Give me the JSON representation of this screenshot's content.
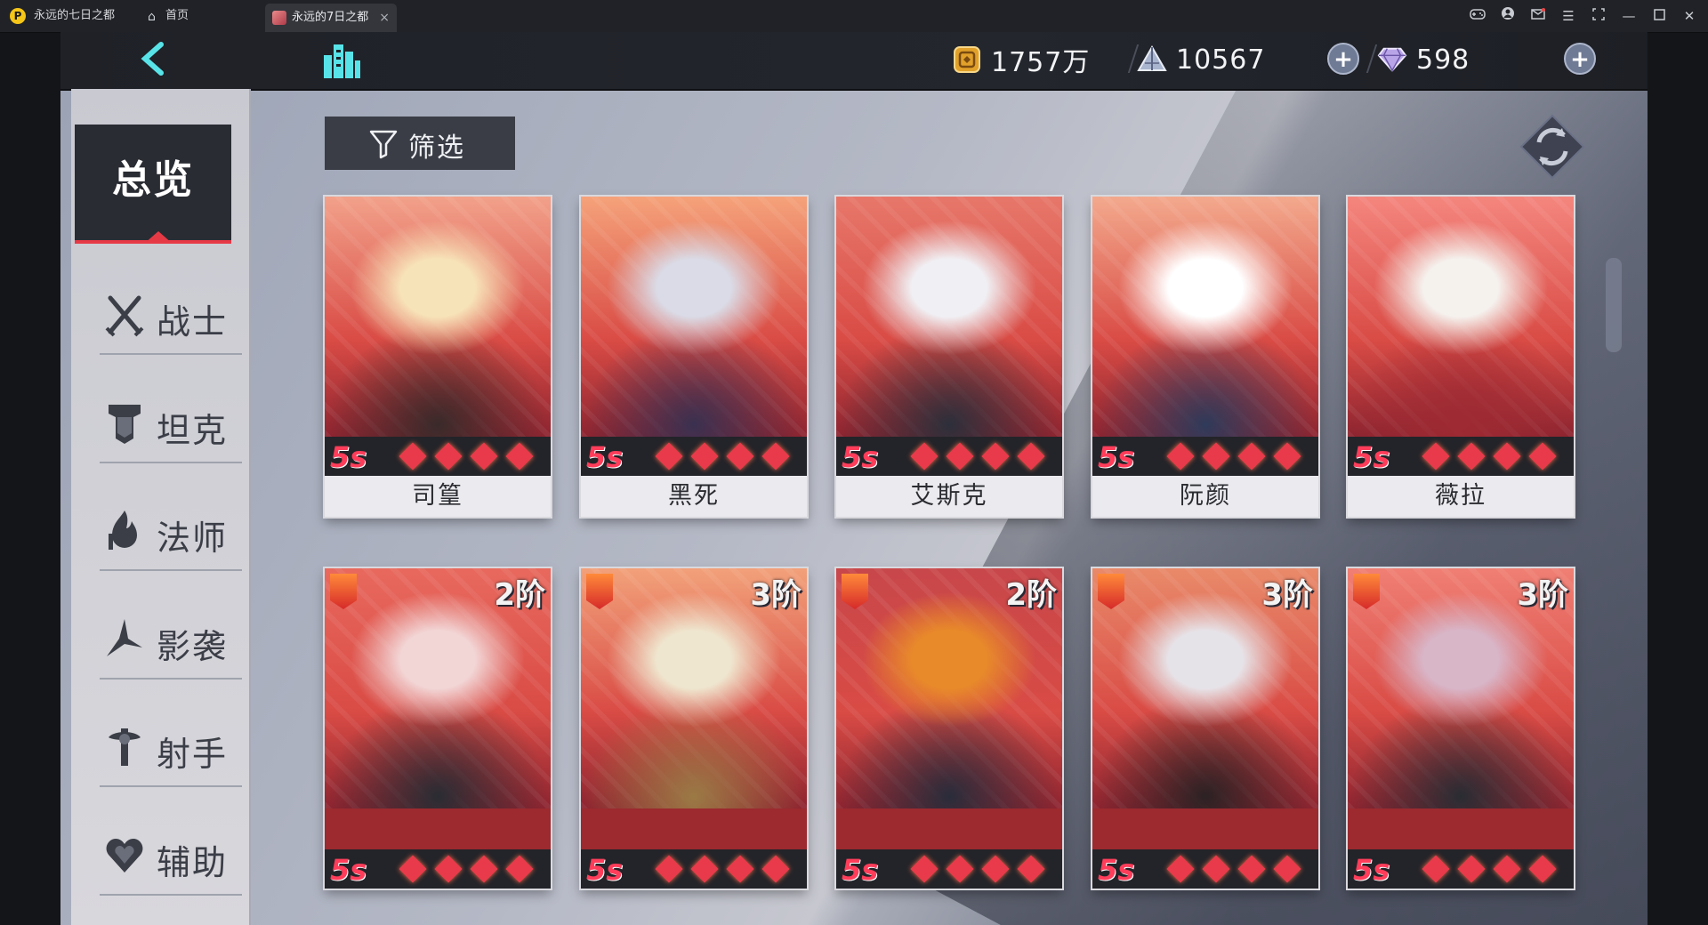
{
  "browser": {
    "app_title": "永远的七日之都",
    "home_tab": "首页",
    "game_tab": "永远的7日之都",
    "tab_close": "×"
  },
  "topbar": {
    "resources": [
      {
        "icon": "gold-coin-icon",
        "value": "1757万"
      },
      {
        "icon": "crystal-pyramid-icon",
        "value": "10567"
      },
      {
        "icon": "diamond-gem-icon",
        "value": "598"
      }
    ],
    "plus": "+"
  },
  "sidebar": {
    "overview": "总览",
    "categories": [
      {
        "icon": "swords-icon",
        "label": "战士"
      },
      {
        "icon": "tank-shield-icon",
        "label": "坦克"
      },
      {
        "icon": "mage-icon",
        "label": "法师"
      },
      {
        "icon": "shadow-blade-icon",
        "label": "影袭"
      },
      {
        "icon": "archer-icon",
        "label": "射手"
      },
      {
        "icon": "support-heart-icon",
        "label": "辅助"
      }
    ]
  },
  "filter": {
    "label": "筛选"
  },
  "cards_row1": [
    {
      "name": "司篁",
      "grade": "5s",
      "stars": 4,
      "art": [
        "#f2a18a",
        "#f7e3b8",
        "#3a2a2a"
      ]
    },
    {
      "name": "黑死",
      "grade": "5s",
      "stars": 4,
      "art": [
        "#f5a27a",
        "#dadbe6",
        "#3a3050"
      ]
    },
    {
      "name": "艾斯克",
      "grade": "5s",
      "stars": 4,
      "art": [
        "#e7776a",
        "#f0f0f4",
        "#2c2f3a"
      ]
    },
    {
      "name": "阮颜",
      "grade": "5s",
      "stars": 4,
      "art": [
        "#f3a98d",
        "#ffffff",
        "#2f3a5a"
      ]
    },
    {
      "name": "薇拉",
      "grade": "5s",
      "stars": 4,
      "art": [
        "#f4867e",
        "#f5f2ee",
        "#9e2a33"
      ]
    }
  ],
  "cards_row2": [
    {
      "rank": "2阶",
      "grade": "5s",
      "stars": 4,
      "art": [
        "#e8695e",
        "#f2d6d6",
        "#2a2c33"
      ]
    },
    {
      "rank": "3阶",
      "grade": "5s",
      "stars": 4,
      "art": [
        "#f2a17a",
        "#efe6cf",
        "#9b7a45"
      ]
    },
    {
      "rank": "2阶",
      "grade": "5s",
      "stars": 4,
      "art": [
        "#c8474a",
        "#e88a2a",
        "#2a2c3a"
      ]
    },
    {
      "rank": "3阶",
      "grade": "5s",
      "stars": 4,
      "art": [
        "#e98a6a",
        "#e6e3e8",
        "#2c2224"
      ]
    },
    {
      "rank": "3阶",
      "grade": "5s",
      "stars": 4,
      "art": [
        "#f07f74",
        "#d8b6c8",
        "#2a2c33"
      ]
    }
  ]
}
